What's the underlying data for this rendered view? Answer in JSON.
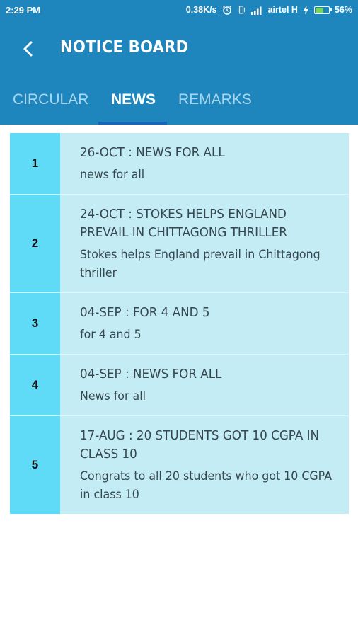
{
  "status_bar": {
    "time": "2:29 PM",
    "speed": "0.38K/s",
    "carrier": "airtel H",
    "battery": "56%",
    "battery_level": 0.56,
    "battery_color": "#7bd35a"
  },
  "header": {
    "title": "NOTICE BOARD",
    "background": "#1e86bd",
    "back_icon": "chevron-left-icon"
  },
  "tabs": [
    {
      "label": "CIRCULAR",
      "active": false
    },
    {
      "label": "NEWS",
      "active": true
    },
    {
      "label": "REMARKS",
      "active": false
    }
  ],
  "notices": [
    {
      "number": "1",
      "title": "26-OCT : NEWS FOR ALL",
      "text": "news for all"
    },
    {
      "number": "2",
      "title": "24-OCT : STOKES HELPS ENGLAND PREVAIL IN CHITTAGONG THRILLER",
      "text": "Stokes helps England prevail in Chittagong thriller"
    },
    {
      "number": "3",
      "title": "04-SEP : FOR 4 AND 5",
      "text": "for 4 and 5"
    },
    {
      "number": "4",
      "title": "04-SEP : NEWS FOR ALL",
      "text": "News for all"
    },
    {
      "number": "5",
      "title": "17-AUG : 20 STUDENTS GOT 10 CGPA IN CLASS 10",
      "text": "Congrats to all  20 students who got 10 CGPA in class 10"
    }
  ],
  "colors": {
    "number_cell": "#5fdbf7",
    "body_cell": "#c3ecf5",
    "tab_indicator": "#1565b8"
  }
}
